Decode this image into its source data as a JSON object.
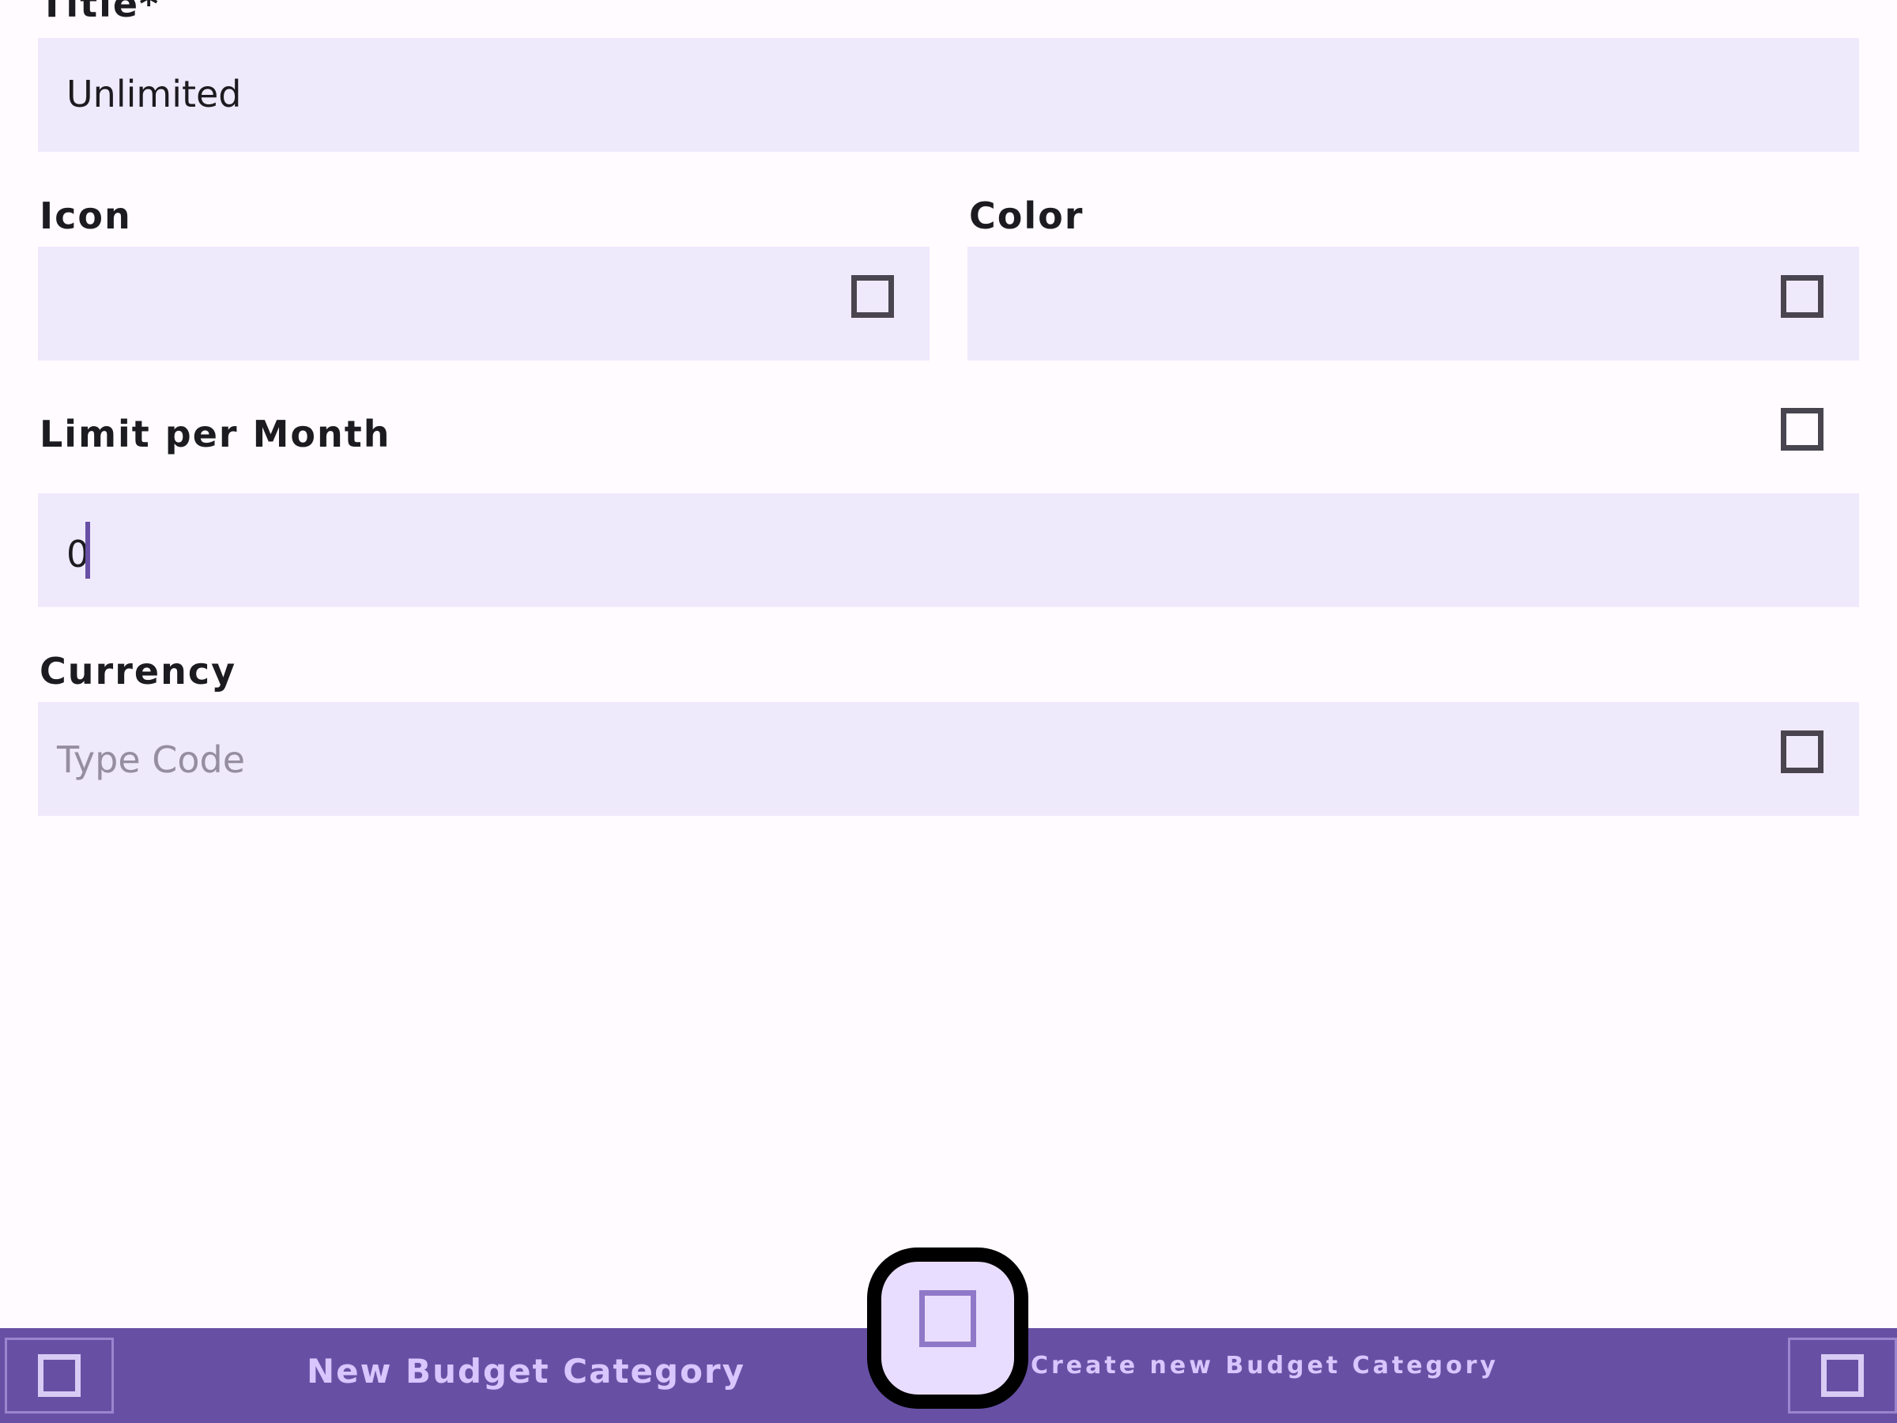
{
  "form": {
    "title": {
      "label": "Title*",
      "value": "Unlimited"
    },
    "icon": {
      "label": "Icon",
      "trailing_icon": "square-icon"
    },
    "color": {
      "label": "Color",
      "trailing_icon": "square-icon"
    },
    "limit": {
      "label": "Limit per Month",
      "toggle_icon": "square-icon",
      "value": "0"
    },
    "currency": {
      "label": "Currency",
      "placeholder": "Type Code",
      "trailing_icon": "square-icon"
    }
  },
  "bottom_bar": {
    "left_button_icon": "square-icon",
    "title": "New Budget Category",
    "fab_icon": "square-icon",
    "fab_tooltip": "Create new Budget Category",
    "right_button_icon": "square-icon"
  },
  "colors": {
    "primary": "#6750a4",
    "field_background": "#efe9fc",
    "on_primary_text": "#d8c6ff",
    "fab_container": "#e9ddff"
  }
}
